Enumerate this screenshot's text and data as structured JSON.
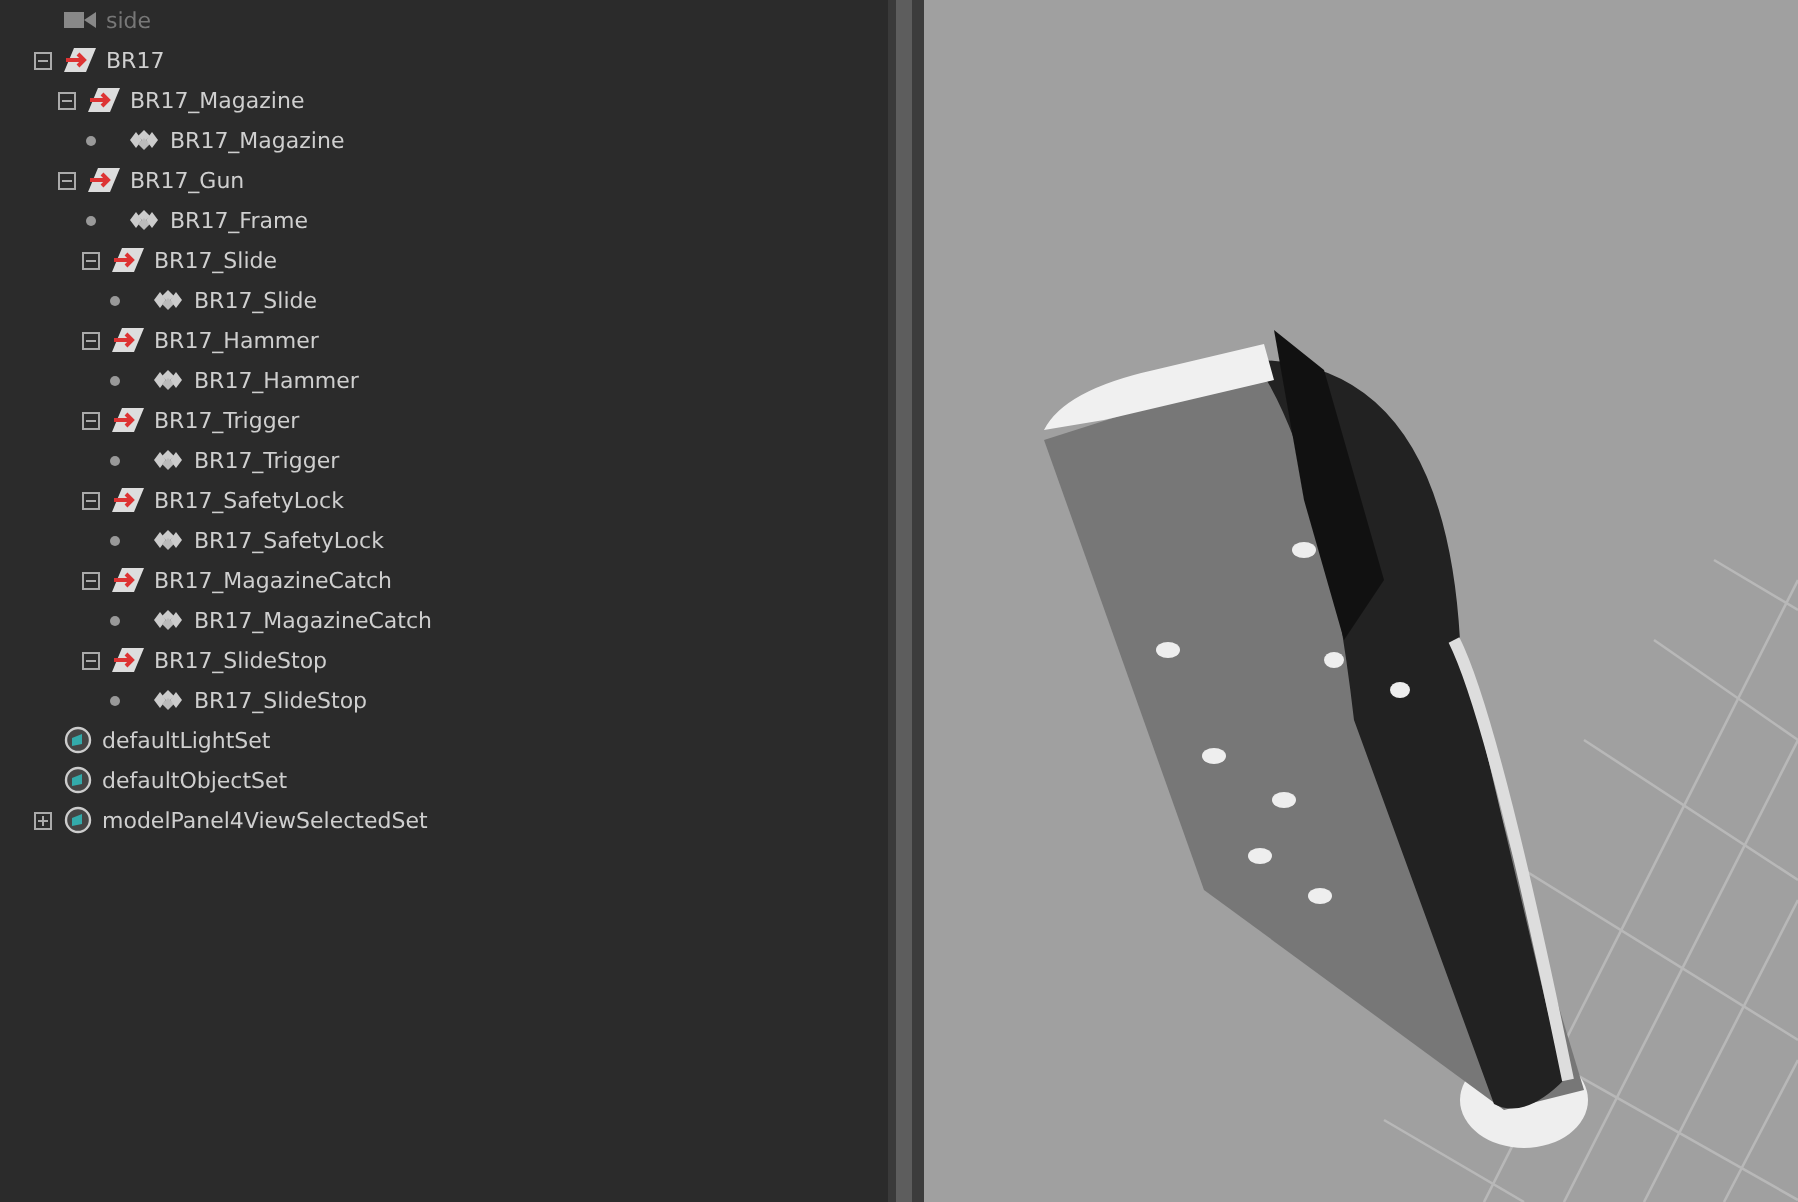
{
  "outliner": {
    "items": [
      {
        "kind": "camera",
        "label": "side"
      },
      {
        "kind": "group",
        "label": "BR17",
        "expanded": true,
        "children": [
          {
            "kind": "group",
            "label": "BR17_Magazine",
            "expanded": true,
            "children": [
              {
                "kind": "mesh",
                "label": "BR17_Magazine"
              }
            ]
          },
          {
            "kind": "group",
            "label": "BR17_Gun",
            "expanded": true,
            "children": [
              {
                "kind": "mesh",
                "label": "BR17_Frame"
              },
              {
                "kind": "group",
                "label": "BR17_Slide",
                "expanded": true,
                "children": [
                  {
                    "kind": "mesh",
                    "label": "BR17_Slide"
                  }
                ]
              },
              {
                "kind": "group",
                "label": "BR17_Hammer",
                "expanded": true,
                "children": [
                  {
                    "kind": "mesh",
                    "label": "BR17_Hammer"
                  }
                ]
              },
              {
                "kind": "group",
                "label": "BR17_Trigger",
                "expanded": true,
                "children": [
                  {
                    "kind": "mesh",
                    "label": "BR17_Trigger"
                  }
                ]
              },
              {
                "kind": "group",
                "label": "BR17_SafetyLock",
                "expanded": true,
                "children": [
                  {
                    "kind": "mesh",
                    "label": "BR17_SafetyLock"
                  }
                ]
              },
              {
                "kind": "group",
                "label": "BR17_MagazineCatch",
                "expanded": true,
                "children": [
                  {
                    "kind": "mesh",
                    "label": "BR17_MagazineCatch"
                  }
                ]
              },
              {
                "kind": "group",
                "label": "BR17_SlideStop",
                "expanded": true,
                "children": [
                  {
                    "kind": "mesh",
                    "label": "BR17_SlideStop"
                  }
                ]
              }
            ]
          }
        ]
      },
      {
        "kind": "set",
        "label": "defaultLightSet"
      },
      {
        "kind": "set",
        "label": "defaultObjectSet"
      },
      {
        "kind": "set",
        "label": "modelPanel4ViewSelectedSet",
        "expanded": false
      }
    ]
  }
}
